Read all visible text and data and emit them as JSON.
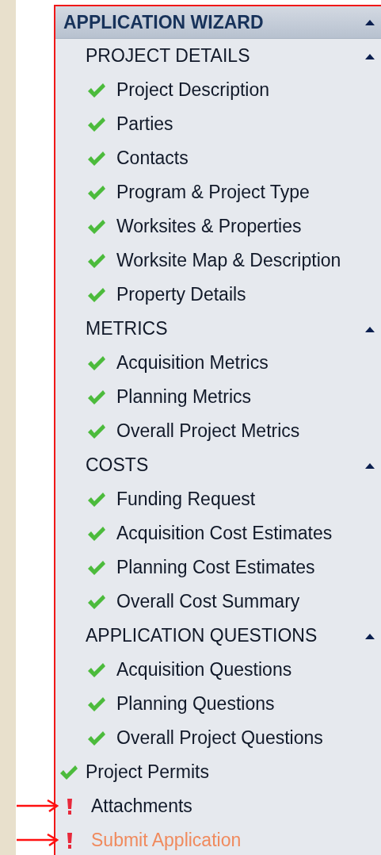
{
  "wizard": {
    "title": "APPLICATION WIZARD",
    "expanded": true,
    "sections": [
      {
        "label": "PROJECT DETAILS",
        "expanded": true,
        "items": [
          {
            "label": "Project Description",
            "complete": true
          },
          {
            "label": "Parties",
            "complete": true
          },
          {
            "label": "Contacts",
            "complete": true
          },
          {
            "label": "Program & Project Type",
            "complete": true
          },
          {
            "label": "Worksites & Properties",
            "complete": true
          },
          {
            "label": "Worksite Map & Description",
            "complete": true
          },
          {
            "label": "Property Details",
            "complete": true
          }
        ]
      },
      {
        "label": "METRICS",
        "expanded": true,
        "items": [
          {
            "label": "Acquisition Metrics",
            "complete": true
          },
          {
            "label": "Planning Metrics",
            "complete": true
          },
          {
            "label": "Overall Project Metrics",
            "complete": true
          }
        ]
      },
      {
        "label": "COSTS",
        "expanded": true,
        "items": [
          {
            "label": "Funding Request",
            "complete": true
          },
          {
            "label": "Acquisition Cost Estimates",
            "complete": true
          },
          {
            "label": "Planning Cost Estimates",
            "complete": true
          },
          {
            "label": "Overall Cost Summary",
            "complete": true
          }
        ]
      },
      {
        "label": "APPLICATION QUESTIONS",
        "expanded": true,
        "items": [
          {
            "label": "Acquisition Questions",
            "complete": true
          },
          {
            "label": "Planning Questions",
            "complete": true
          },
          {
            "label": "Overall Project Questions",
            "complete": true
          }
        ]
      }
    ],
    "steps": [
      {
        "label": "Project Permits",
        "complete": true,
        "disabled": false,
        "annotated": false
      },
      {
        "label": "Attachments",
        "complete": false,
        "disabled": false,
        "annotated": true
      },
      {
        "label": "Submit Application",
        "complete": false,
        "disabled": true,
        "annotated": true
      }
    ]
  }
}
